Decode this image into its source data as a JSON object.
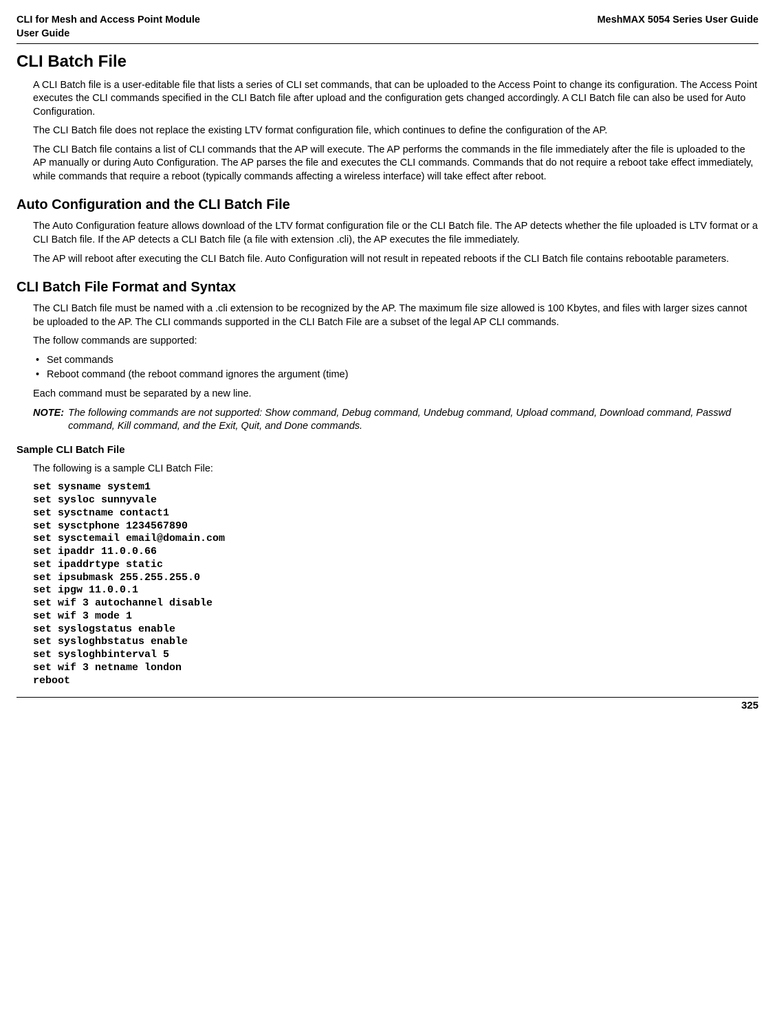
{
  "header": {
    "left_line1": "CLI for Mesh and Access Point Module",
    "left_line2": " User Guide",
    "right": "MeshMAX 5054 Series User Guide"
  },
  "h1": "CLI Batch File",
  "p1": "A CLI Batch file is a user-editable file that lists a series of CLI set commands, that can be uploaded to the Access Point to change its configuration. The Access Point executes the CLI commands specified in the CLI Batch file after upload and the configuration gets changed accordingly. A CLI Batch file can also be used for Auto Configuration.",
  "p2": "The CLI Batch file does not replace the existing LTV format configuration file, which continues to define the configuration of the AP.",
  "p3": "The CLI Batch file contains a list of CLI commands that the AP will execute. The AP performs the commands in the file immediately after the file is uploaded to the AP manually or during Auto Configuration. The AP parses the file and executes the CLI commands. Commands that do not require a reboot take effect immediately, while commands that require a reboot (typically commands affecting a wireless interface) will take effect after reboot.",
  "h2a": "Auto Configuration and the CLI Batch File",
  "p4": "The Auto Configuration feature allows download of the LTV format configuration file or the CLI Batch file. The AP detects whether the file uploaded is LTV format or a CLI Batch file. If the AP detects a CLI Batch file (a file with extension .cli), the AP executes the file immediately.",
  "p5": "The AP will reboot after executing the CLI Batch file. Auto Configuration will not result in repeated reboots if the CLI Batch file contains rebootable parameters.",
  "h2b": "CLI Batch File Format and Syntax",
  "p6": "The CLI Batch file must be named with a .cli extension to be recognized by the AP. The maximum file size allowed is 100 Kbytes, and files with larger sizes cannot be uploaded to the AP. The CLI commands supported in the CLI Batch File are a subset of the legal AP CLI commands.",
  "p7": "The follow commands are supported:",
  "bullets": {
    "b1": "Set commands",
    "b2": "Reboot command (the reboot command ignores the argument (time)"
  },
  "p8": "Each command must be separated by a new line.",
  "note": {
    "label": "NOTE:",
    "text": "The following commands are not supported: Show command, Debug command, Undebug command, Upload command, Download command, Passwd command, Kill command, and the Exit, Quit, and Done commands."
  },
  "h3a": "Sample CLI Batch File",
  "p9": "The following is a sample CLI Batch File:",
  "code": "set sysname system1\nset sysloc sunnyvale\nset sysctname contact1\nset sysctphone 1234567890\nset sysctemail email@domain.com\nset ipaddr 11.0.0.66\nset ipaddrtype static\nset ipsubmask 255.255.255.0\nset ipgw 11.0.0.1\nset wif 3 autochannel disable\nset wif 3 mode 1\nset syslogstatus enable\nset sysloghbstatus enable\nset sysloghbinterval 5\nset wif 3 netname london\nreboot",
  "pagenum": "325"
}
